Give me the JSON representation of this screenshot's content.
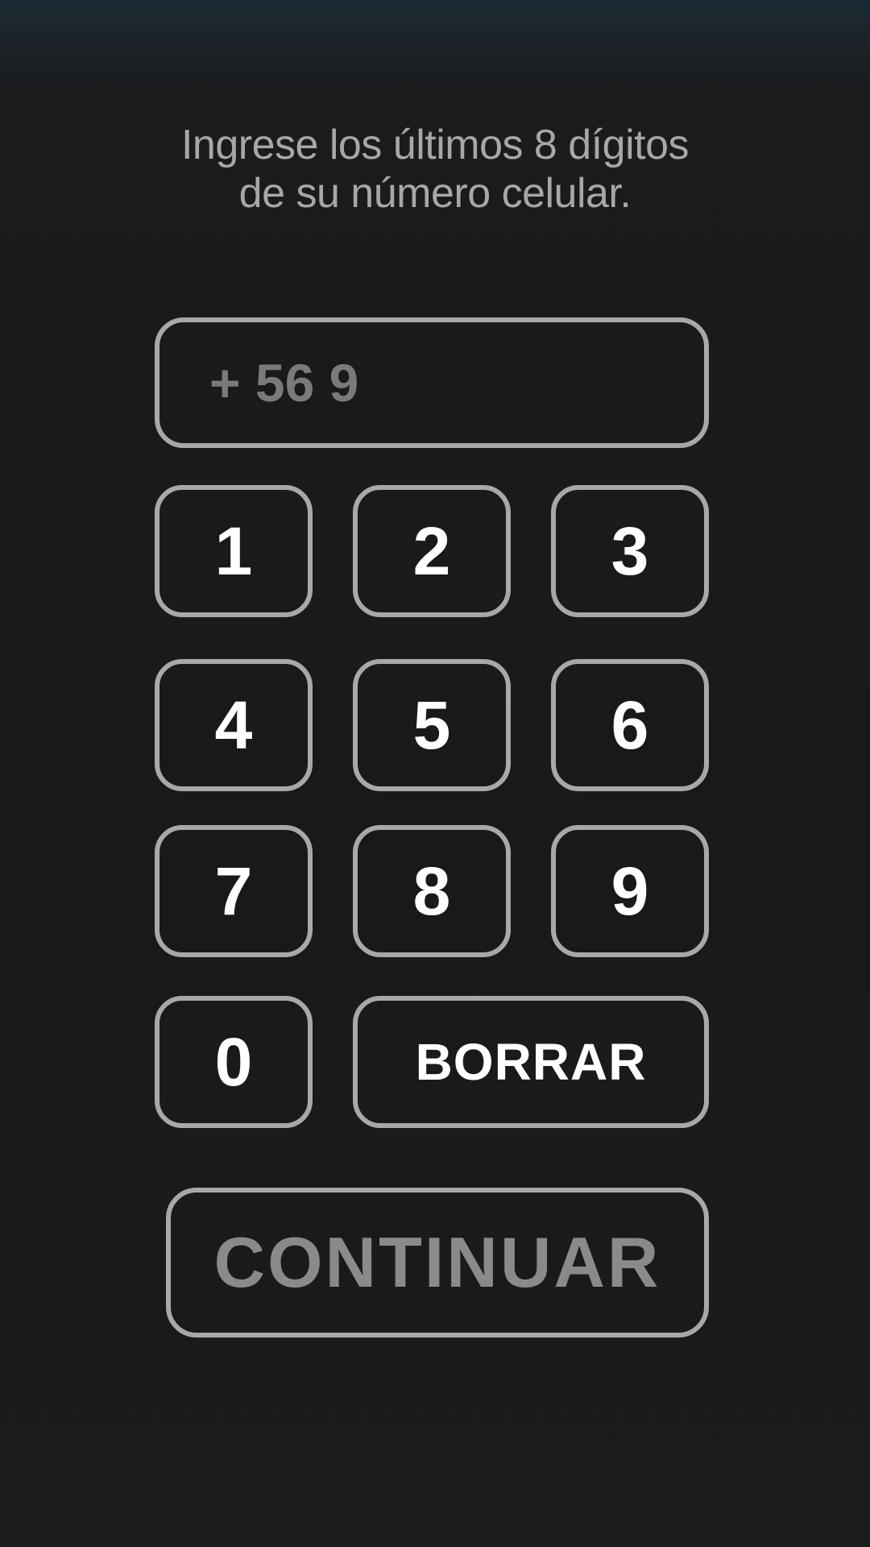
{
  "instructions": {
    "line1": "Ingrese los últimos 8 dígitos",
    "line2": "de su número celular."
  },
  "phone_field": {
    "prefix": "+ 56 9"
  },
  "keypad": {
    "k1": "1",
    "k2": "2",
    "k3": "3",
    "k4": "4",
    "k5": "5",
    "k6": "6",
    "k7": "7",
    "k8": "8",
    "k9": "9",
    "k0": "0",
    "delete": "BORRAR"
  },
  "continue_button": {
    "label": "CONTINUAR"
  }
}
